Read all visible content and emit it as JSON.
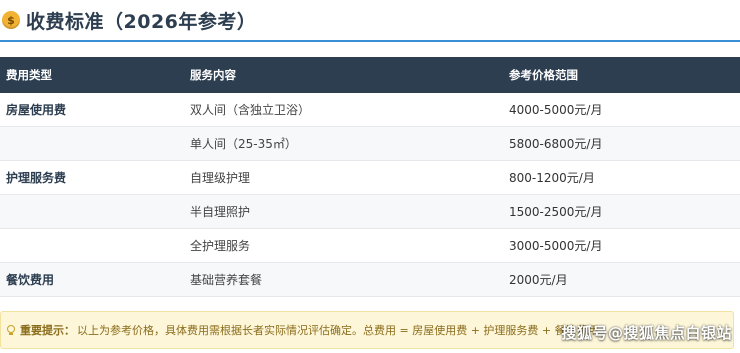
{
  "header": {
    "icon": "money-bag-icon",
    "title": "收费标准（2026年参考）"
  },
  "table": {
    "columns": [
      "费用类型",
      "服务内容",
      "参考价格范围"
    ],
    "rows": [
      {
        "type": "房屋使用费",
        "service": "双人间（含独立卫浴）",
        "price": "4000-5000元/月"
      },
      {
        "type": "",
        "service": "单人间（25-35㎡）",
        "price": "5800-6800元/月"
      },
      {
        "type": "护理服务费",
        "service": "自理级护理",
        "price": "800-1200元/月"
      },
      {
        "type": "",
        "service": "半自理照护",
        "price": "1500-2500元/月"
      },
      {
        "type": "",
        "service": "全护理服务",
        "price": "3000-5000元/月"
      },
      {
        "type": "餐饮费用",
        "service": "基础营养套餐",
        "price": "2000元/月"
      }
    ]
  },
  "note": {
    "icon": "lightbulb-icon",
    "label": "重要提示：",
    "text": "以上为参考价格，具体费用需根据长者实际情况评估确定。总费用 = 房屋使用费 + 护理服务费 + 餐饮费用"
  },
  "watermark": "搜狐号@搜狐焦点白银站",
  "colors": {
    "header_bg": "#2c3e50",
    "title_underline": "#3b8fd6",
    "note_bg": "#fdf6d8",
    "note_text": "#8a6d1d"
  }
}
